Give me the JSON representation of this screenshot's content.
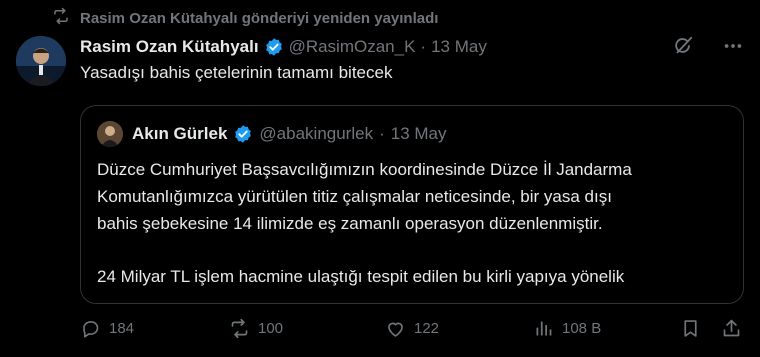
{
  "repost": {
    "icon": "repost-icon",
    "text": "Rasim Ozan Kütahyalı gönderiyi yeniden yayınladı"
  },
  "tweet": {
    "author_name": "Rasim Ozan Kütahyalı",
    "verified": true,
    "handle": "@RasimOzan_K",
    "separator": "·",
    "date": "13 May",
    "text": "Yasadışı bahis çetelerinin tamamı bitecek",
    "top_icons": [
      "grok-icon",
      "more-icon"
    ]
  },
  "quote": {
    "author_name": "Akın Gürlek",
    "verified": true,
    "handle": "@abakingurlek",
    "separator": "·",
    "date": "13 May",
    "lines": [
      "Düzce Cumhuriyet Başsavcılığımızın koordinesinde Düzce İl Jandarma",
      "Komutanlığımızca yürütülen titiz çalışmalar neticesinde, bir yasa dışı",
      "bahis şebekesine 14 ilimizde eş zamanlı operasyon düzenlenmiştir."
    ],
    "line_after_gap": "24 Milyar TL işlem hacmine ulaştığı tespit edilen bu kirli yapıya yönelik"
  },
  "actions": {
    "replies": "184",
    "reposts": "100",
    "likes": "122",
    "views": "108 B"
  },
  "colors": {
    "background": "#000000",
    "text": "#e7e9ea",
    "muted": "#71767b",
    "border": "#2f3336",
    "verified": "#1d9bf0"
  }
}
